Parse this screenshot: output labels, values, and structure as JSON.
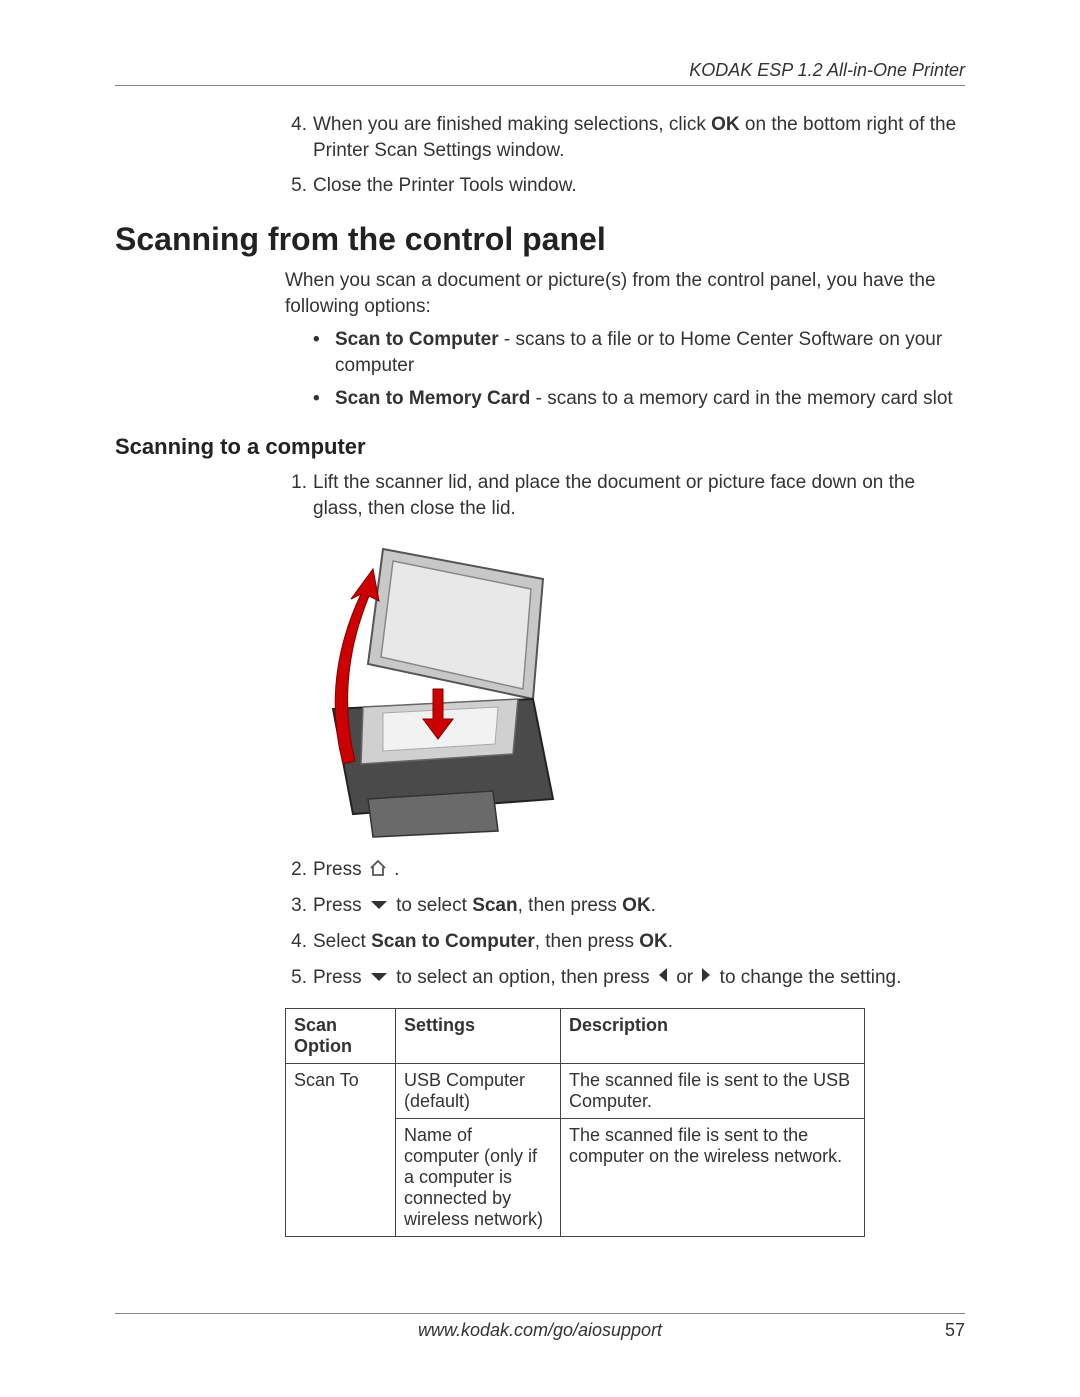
{
  "header": {
    "title": "KODAK ESP 1.2 All-in-One Printer"
  },
  "prev_steps": [
    {
      "num": "4.",
      "pre": "When you are finished making selections, click ",
      "bold": "OK",
      "post": " on the bottom right of the Printer Scan Settings window."
    },
    {
      "num": "5.",
      "text": "Close the Printer Tools window."
    }
  ],
  "h1": "Scanning from the control panel",
  "intro": "When you scan a document or picture(s) from the control panel, you have the following options:",
  "bullets": [
    {
      "bold": "Scan to Computer",
      "rest": " - scans to a file or to Home Center Software on your computer"
    },
    {
      "bold": "Scan to Memory Card",
      "rest": " - scans to a memory card in the memory card slot"
    }
  ],
  "h2": "Scanning to a computer",
  "steps": {
    "s1": {
      "num": "1.",
      "text": "Lift the scanner lid, and place the document or picture face down on the glass, then close the lid."
    },
    "s2": {
      "num": "2.",
      "pre": "Press ",
      "post": "."
    },
    "s3": {
      "num": "3.",
      "pre": "Press ",
      "mid": " to select ",
      "bold1": "Scan",
      "post1": ", then press ",
      "bold2": "OK",
      "post2": "."
    },
    "s4": {
      "num": "4.",
      "pre": "Select ",
      "bold1": "Scan to Computer",
      "post1": ", then press ",
      "bold2": "OK",
      "post2": "."
    },
    "s5": {
      "num": "5.",
      "pre": "Press ",
      "mid": " to select an option, then press ",
      "mid2": " or ",
      "post": " to change the setting."
    }
  },
  "table": {
    "headers": {
      "c1": "Scan Option",
      "c2": "Settings",
      "c3": "Description"
    },
    "rows": [
      {
        "opt": "Scan To",
        "setting": "USB Computer (default)",
        "desc": "The scanned file is sent to the USB Computer."
      },
      {
        "opt": "",
        "setting": "Name of computer (only if a computer is connected by wireless network)",
        "desc": "The scanned file is sent to the computer on the wireless network."
      }
    ]
  },
  "footer": {
    "url": "www.kodak.com/go/aiosupport",
    "page": "57"
  }
}
